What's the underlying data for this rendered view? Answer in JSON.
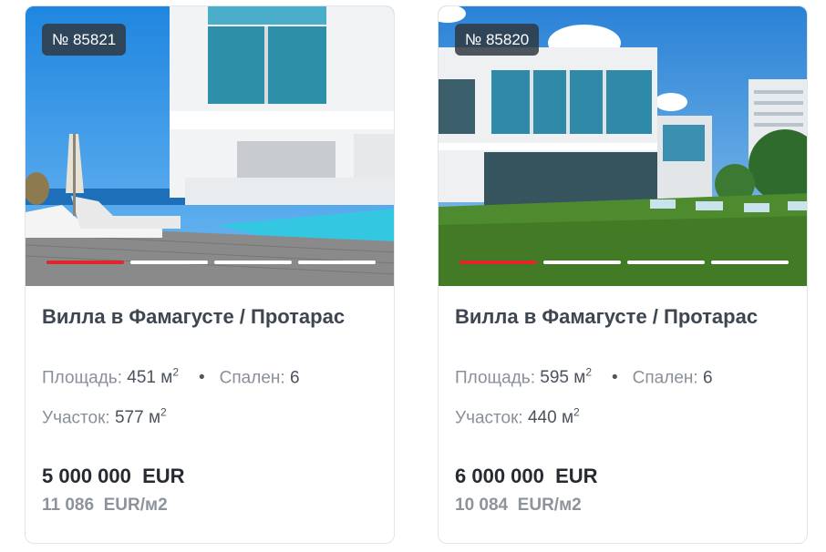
{
  "listings": [
    {
      "id_label": "№ 85821",
      "title": "Вилла в Фамагусте / Протарас",
      "area_label": "Площадь:",
      "area_value": "451 м",
      "area_sup": "2",
      "separator": "•",
      "bedrooms_label": "Спален:",
      "bedrooms_value": "6",
      "plot_label": "Участок:",
      "plot_value": "577 м",
      "plot_sup": "2",
      "price": "5 000 000  EUR",
      "price_per_m2": "11 086  EUR/м2",
      "slides_total": 4,
      "slide_active": 1
    },
    {
      "id_label": "№ 85820",
      "title": "Вилла в Фамагусте / Протарас",
      "area_label": "Площадь:",
      "area_value": "595 м",
      "area_sup": "2",
      "separator": "•",
      "bedrooms_label": "Спален:",
      "bedrooms_value": "6",
      "plot_label": "Участок:",
      "plot_value": "440 м",
      "plot_sup": "2",
      "price": "6 000 000  EUR",
      "price_per_m2": "10 084  EUR/м2",
      "slides_total": 4,
      "slide_active": 1
    }
  ],
  "colors": {
    "active_slide": "#e0262a",
    "inactive_slide": "#ffffff",
    "badge_bg": "#303842"
  }
}
